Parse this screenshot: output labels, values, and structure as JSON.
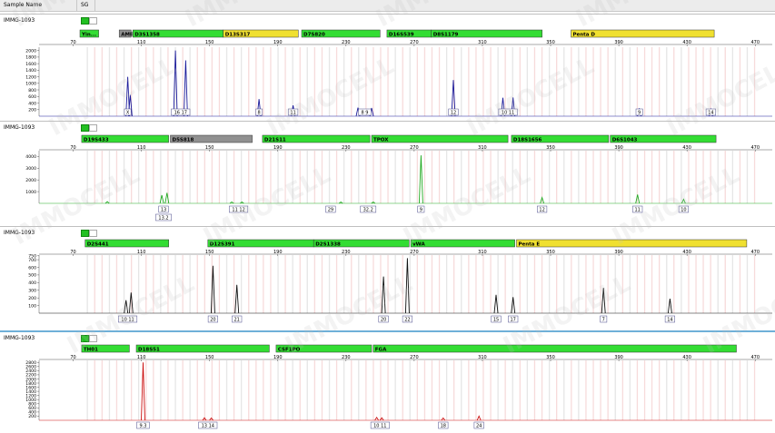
{
  "header": {
    "sample_name_label": "Sample Name",
    "sample_value": "SG"
  },
  "watermark": "IMMOCELL",
  "colors": {
    "locus_green": "#33dd33",
    "locus_yellow": "#f0e030",
    "locus_gray": "#909090",
    "bin_shade": "#f4cccc",
    "bin_gray": "#dcdcdc"
  },
  "panels": [
    {
      "sample": "IMMG-1093",
      "dye": "blue",
      "color": "#1a1a9a",
      "x_ticks": [
        70,
        110,
        150,
        190,
        230,
        270,
        310,
        350,
        390,
        430,
        470
      ],
      "y_ticks": [
        "2000",
        "1800",
        "1600",
        "1400",
        "1200",
        "1000",
        "800",
        "600",
        "400",
        "200"
      ],
      "y_max": 2100,
      "loci": [
        {
          "name": "Yin...",
          "start": 74,
          "end": 85,
          "type": "green"
        },
        {
          "name": "AMEL",
          "start": 97,
          "end": 104,
          "type": "gray"
        },
        {
          "name": "D3S1358",
          "start": 105,
          "end": 158,
          "type": "green"
        },
        {
          "name": "D13S317",
          "start": 158,
          "end": 202,
          "type": "yellow"
        },
        {
          "name": "D7S820",
          "start": 204,
          "end": 250,
          "type": "green"
        },
        {
          "name": "D16S539",
          "start": 254,
          "end": 280,
          "type": "green"
        },
        {
          "name": "D8S1179",
          "start": 280,
          "end": 345,
          "type": "green"
        },
        {
          "name": "Penta D",
          "start": 362,
          "end": 446,
          "type": "yellow"
        }
      ],
      "peaks": [
        {
          "x": 102,
          "h": 1200
        },
        {
          "x": 103.5,
          "h": 650
        },
        {
          "x": 130,
          "h": 2000
        },
        {
          "x": 136,
          "h": 1700
        },
        {
          "x": 179,
          "h": 520
        },
        {
          "x": 199,
          "h": 330
        },
        {
          "x": 237,
          "h": 260
        },
        {
          "x": 245,
          "h": 250
        },
        {
          "x": 293,
          "h": 1100
        },
        {
          "x": 322,
          "h": 560
        },
        {
          "x": 328,
          "h": 570
        },
        {
          "x": 402,
          "h": 240
        },
        {
          "x": 444,
          "h": 210
        }
      ],
      "labels": [
        {
          "x": 102,
          "text": "X"
        },
        {
          "x": 133,
          "text": "16 17"
        },
        {
          "x": 179,
          "text": "8"
        },
        {
          "x": 199,
          "text": "11"
        },
        {
          "x": 241,
          "text": "8 9"
        },
        {
          "x": 293,
          "text": "12"
        },
        {
          "x": 325,
          "text": "10 11"
        },
        {
          "x": 402,
          "text": "9"
        },
        {
          "x": 444,
          "text": "14"
        }
      ]
    },
    {
      "sample": "IMMG-1093",
      "dye": "green",
      "color": "#22aa22",
      "x_ticks": [
        70,
        110,
        150,
        190,
        230,
        270,
        310,
        350,
        390,
        430,
        470
      ],
      "y_ticks": [
        "4000",
        "3000",
        "2000",
        "1000"
      ],
      "y_max": 4500,
      "loci": [
        {
          "name": "D19S433",
          "start": 75,
          "end": 126,
          "type": "green"
        },
        {
          "name": "D5S818",
          "start": 127,
          "end": 175,
          "type": "gray"
        },
        {
          "name": "D21S11",
          "start": 181,
          "end": 244,
          "type": "green"
        },
        {
          "name": "TPOX",
          "start": 245,
          "end": 325,
          "type": "green"
        },
        {
          "name": "D18S1656",
          "start": 327,
          "end": 384,
          "type": "green"
        },
        {
          "name": "D6S1043",
          "start": 385,
          "end": 447,
          "type": "green"
        }
      ],
      "peaks": [
        {
          "x": 90,
          "h": 150
        },
        {
          "x": 122,
          "h": 700
        },
        {
          "x": 125,
          "h": 900
        },
        {
          "x": 163,
          "h": 120
        },
        {
          "x": 169,
          "h": 110
        },
        {
          "x": 227,
          "h": 110
        },
        {
          "x": 246,
          "h": 110
        },
        {
          "x": 274,
          "h": 4100
        },
        {
          "x": 345,
          "h": 500
        },
        {
          "x": 401,
          "h": 750
        },
        {
          "x": 428,
          "h": 350
        }
      ],
      "labels": [
        {
          "x": 123,
          "text": "13"
        },
        {
          "x": 167,
          "text": "11 12"
        },
        {
          "x": 221,
          "text": "29"
        },
        {
          "x": 243,
          "text": "32.2"
        },
        {
          "x": 274,
          "text": "9"
        },
        {
          "x": 345,
          "text": "12"
        },
        {
          "x": 401,
          "text": "11"
        },
        {
          "x": 428,
          "text": "10"
        }
      ],
      "labels2": [
        {
          "x": 123,
          "text": "13.2"
        }
      ]
    },
    {
      "sample": "IMMG-1093",
      "dye": "black",
      "color": "#111111",
      "x_ticks": [
        70,
        110,
        150,
        190,
        230,
        270,
        310,
        350,
        390,
        430,
        470
      ],
      "y_ticks": [
        "750",
        "700",
        "600",
        "500",
        "400",
        "300",
        "200",
        "100"
      ],
      "y_max": 760,
      "loci": [
        {
          "name": "D2S441",
          "start": 77,
          "end": 126,
          "type": "green"
        },
        {
          "name": "D12S391",
          "start": 149,
          "end": 211,
          "type": "green"
        },
        {
          "name": "D2S1338",
          "start": 211,
          "end": 267,
          "type": "green"
        },
        {
          "name": "vWA",
          "start": 268,
          "end": 329,
          "type": "green"
        },
        {
          "name": "Penta E",
          "start": 330,
          "end": 465,
          "type": "yellow"
        }
      ],
      "peaks": [
        {
          "x": 101,
          "h": 170
        },
        {
          "x": 104,
          "h": 270
        },
        {
          "x": 152,
          "h": 620
        },
        {
          "x": 166,
          "h": 370
        },
        {
          "x": 252,
          "h": 480
        },
        {
          "x": 266,
          "h": 720
        },
        {
          "x": 318,
          "h": 240
        },
        {
          "x": 328,
          "h": 210
        },
        {
          "x": 381,
          "h": 330
        },
        {
          "x": 420,
          "h": 190
        }
      ],
      "labels": [
        {
          "x": 102,
          "text": "10 11"
        },
        {
          "x": 152,
          "text": "20"
        },
        {
          "x": 166,
          "text": "21"
        },
        {
          "x": 252,
          "text": "20"
        },
        {
          "x": 266,
          "text": "22"
        },
        {
          "x": 318,
          "text": "15"
        },
        {
          "x": 328,
          "text": "17"
        },
        {
          "x": 381,
          "text": "7"
        },
        {
          "x": 420,
          "text": "14"
        }
      ]
    },
    {
      "sample": "IMMG-1093",
      "dye": "red",
      "color": "#cc1111",
      "x_ticks": [
        70,
        110,
        150,
        190,
        230,
        270,
        310,
        350,
        390,
        430,
        470
      ],
      "y_ticks": [
        "2800",
        "2600",
        "2400",
        "2200",
        "2000",
        "1800",
        "1600",
        "1400",
        "1200",
        "1000",
        "800",
        "600",
        "400",
        "200"
      ],
      "y_max": 2900,
      "loci": [
        {
          "name": "TH01",
          "start": 75,
          "end": 103,
          "type": "green"
        },
        {
          "name": "D18S51",
          "start": 107,
          "end": 185,
          "type": "green"
        },
        {
          "name": "CSF1PO",
          "start": 189,
          "end": 245,
          "type": "green"
        },
        {
          "name": "FGA",
          "start": 246,
          "end": 459,
          "type": "green"
        }
      ],
      "peaks": [
        {
          "x": 111,
          "h": 2800
        },
        {
          "x": 147,
          "h": 120
        },
        {
          "x": 151,
          "h": 110
        },
        {
          "x": 248,
          "h": 140
        },
        {
          "x": 251,
          "h": 120
        },
        {
          "x": 287,
          "h": 110
        },
        {
          "x": 308,
          "h": 200
        }
      ],
      "labels": [
        {
          "x": 111,
          "text": "9.3"
        },
        {
          "x": 149,
          "text": "13 14"
        },
        {
          "x": 250,
          "text": "10 11"
        },
        {
          "x": 287,
          "text": "18"
        },
        {
          "x": 308,
          "text": "24"
        }
      ]
    }
  ]
}
